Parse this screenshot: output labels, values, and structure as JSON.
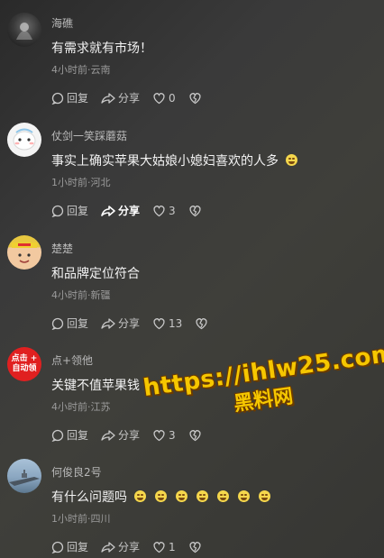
{
  "actions": {
    "reply_label": "回复",
    "share_label": "分享"
  },
  "comments": [
    {
      "username": "海礁",
      "content": "有需求就有市场！",
      "meta": "4小时前·云南",
      "likes": "0",
      "emoji_count": 0,
      "avatar": "dark-avatar"
    },
    {
      "username": "仗剑一笑踩蘑菇",
      "content": "事实上确实苹果大姑娘小媳妇喜欢的人多",
      "meta": "1小时前·河北",
      "likes": "3",
      "emoji_count": 1,
      "avatar": "cartoon-avatar"
    },
    {
      "username": "楚楚",
      "content": "和品牌定位符合",
      "meta": "4小时前·新疆",
      "likes": "13",
      "emoji_count": 0,
      "avatar": "child-avatar"
    },
    {
      "username": "点+领他",
      "content": "关键不值苹果钱",
      "meta": "4小时前·江苏",
      "likes": "3",
      "emoji_count": 0,
      "avatar": "red-avatar",
      "avatar_text": [
        "点击 +",
        "自动领"
      ]
    },
    {
      "username": "何俊良2号",
      "content": "有什么问题吗",
      "meta": "1小时前·四川",
      "likes": "1",
      "emoji_count": 7,
      "avatar": "ship-avatar"
    }
  ],
  "watermark": {
    "url": "https://ihlw25.com",
    "brand": "黑料网"
  },
  "colors": {
    "background": "#333333",
    "watermark": "#f6c700",
    "red_badge": "#e02020"
  }
}
